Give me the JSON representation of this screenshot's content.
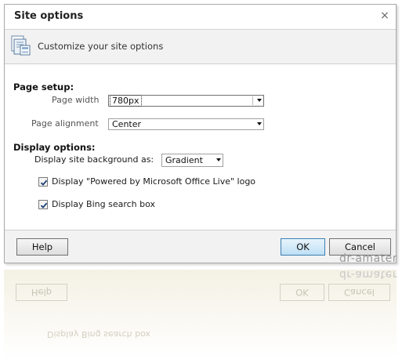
{
  "dialog": {
    "title": "Site options",
    "close_glyph": "×",
    "banner_text": "Customize your site options",
    "banner_icon": "document-options-icon"
  },
  "page_setup": {
    "heading": "Page setup:",
    "width_label": "Page width",
    "width_value": "780px",
    "alignment_label": "Page alignment",
    "alignment_value": "Center"
  },
  "display_options": {
    "heading": "Display options:",
    "background_label": "Display site background as:",
    "background_value": "Gradient",
    "powered_by_label": "Display \"Powered by Microsoft Office Live\" logo",
    "powered_by_checked": true,
    "bing_label": "Display Bing search box",
    "bing_checked": true
  },
  "footer": {
    "help_label": "Help",
    "ok_label": "OK",
    "cancel_label": "Cancel"
  },
  "watermark": "dr-amater",
  "colors": {
    "primary_button": "#bee0f5",
    "panel_gray": "#f2f2f2"
  }
}
